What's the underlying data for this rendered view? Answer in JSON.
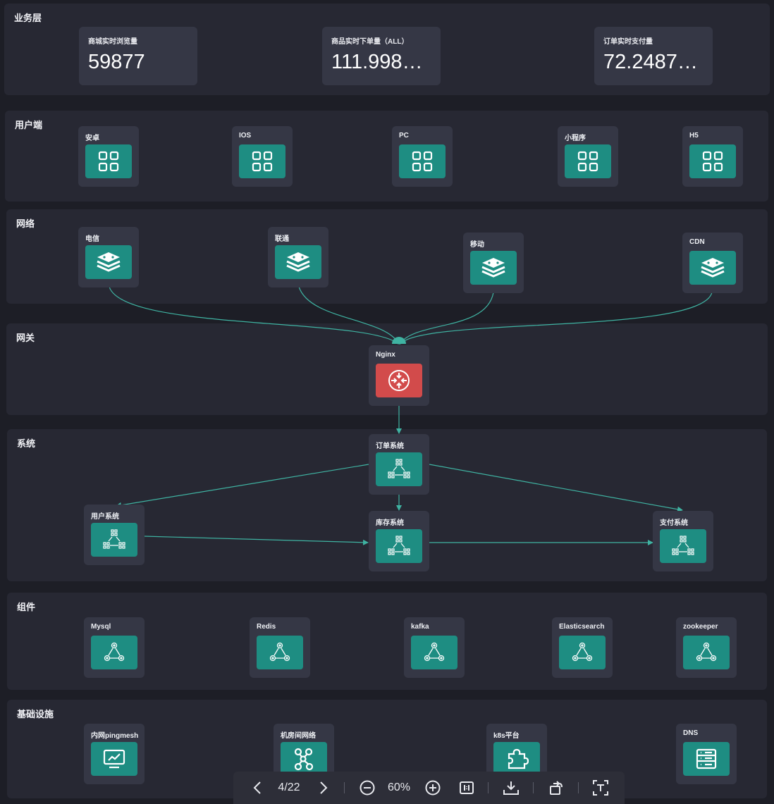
{
  "layers": {
    "business": "业务层",
    "client": "用户端",
    "network": "网络",
    "gateway": "网关",
    "system": "系统",
    "component": "组件",
    "infra": "基础设施"
  },
  "stats": [
    {
      "label": "商城实时浏览量",
      "value": "59877"
    },
    {
      "label": "商品实时下单量（ALL）",
      "value": "111.998…"
    },
    {
      "label": "订单实时支付量",
      "value": "72.2487…"
    }
  ],
  "clients": [
    "安卓",
    "IOS",
    "PC",
    "小程序",
    "H5"
  ],
  "networks": [
    "电信",
    "联通",
    "移动",
    "CDN"
  ],
  "gateway": "Nginx",
  "systems": {
    "order": "订单系统",
    "user": "用户系统",
    "stock": "库存系统",
    "pay": "支付系统"
  },
  "components": [
    "Mysql",
    "Redis",
    "kafka",
    "Elasticsearch",
    "zookeeper"
  ],
  "infra": [
    "内网pingmesh",
    "机房间网络",
    "k8s平台",
    "DNS"
  ],
  "toolbar": {
    "page": "4/22",
    "zoom": "60%"
  },
  "colors": {
    "icon": "#1e8d82",
    "nginx": "#d24b4b",
    "edge": "#3fb3a2",
    "panel": "#272833",
    "card": "#353745"
  },
  "icons": {
    "client": "app-grid-icon",
    "network": "stack-layers-icon",
    "gateway": "router-icon",
    "system": "service-topology-icon",
    "component": "gear-cluster-icon",
    "infra": [
      "monitor-chart-icon",
      "network-nodes-icon",
      "puzzle-icon",
      "server-list-icon"
    ]
  }
}
